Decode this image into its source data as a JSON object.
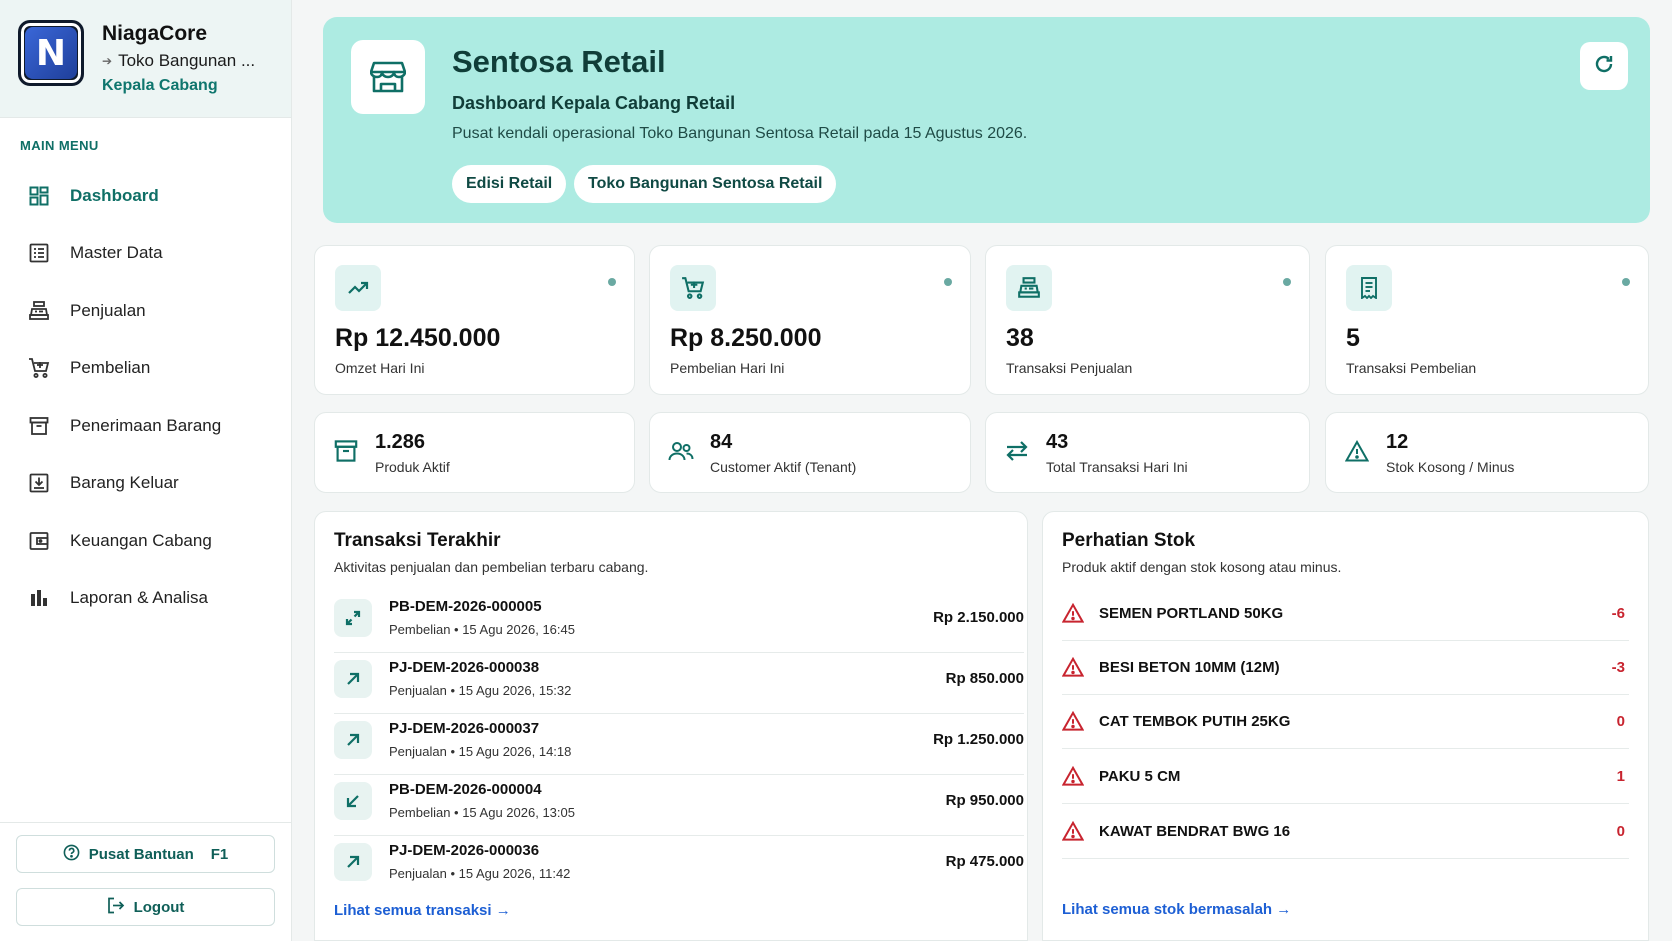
{
  "brand": {
    "name": "NiagaCore",
    "logo_letter": "N",
    "store": "Toko Bangunan ...",
    "role": "Kepala Cabang"
  },
  "sidebar": {
    "menu_title": "MAIN MENU",
    "items": [
      {
        "label": "Dashboard",
        "icon": "dashboard-grid-icon",
        "active": true
      },
      {
        "label": "Master Data",
        "icon": "list-icon"
      },
      {
        "label": "Penjualan",
        "icon": "cash-register-icon"
      },
      {
        "label": "Pembelian",
        "icon": "cart-icon"
      },
      {
        "label": "Penerimaan Barang",
        "icon": "archive-box-icon"
      },
      {
        "label": "Barang Keluar",
        "icon": "box-out-icon"
      },
      {
        "label": "Keuangan Cabang",
        "icon": "wallet-icon"
      },
      {
        "label": "Laporan & Analisa",
        "icon": "bar-chart-icon"
      }
    ],
    "help_label": "Pusat Bantuan",
    "help_key": "F1",
    "logout_label": "Logout"
  },
  "hero": {
    "title": "Sentosa Retail",
    "subtitle": "Dashboard Kepala Cabang Retail",
    "description": "Pusat kendali operasional Toko Bangunan Sentosa Retail pada 15 Agustus 2026.",
    "chips": [
      "Edisi Retail",
      "Toko Bangunan Sentosa Retail"
    ]
  },
  "stats": [
    {
      "value": "Rp 12.450.000",
      "label": "Omzet Hari Ini",
      "icon": "trending-up-icon"
    },
    {
      "value": "Rp 8.250.000",
      "label": "Pembelian Hari Ini",
      "icon": "cart-plus-icon"
    },
    {
      "value": "38",
      "label": "Transaksi Penjualan",
      "icon": "cash-register-icon"
    },
    {
      "value": "5",
      "label": "Transaksi Pembelian",
      "icon": "receipt-icon"
    }
  ],
  "mini_stats": [
    {
      "value": "1.286",
      "label": "Produk Aktif",
      "icon": "archive-box-icon"
    },
    {
      "value": "84",
      "label": "Customer Aktif (Tenant)",
      "icon": "users-icon"
    },
    {
      "value": "43",
      "label": "Total Transaksi Hari Ini",
      "icon": "swap-arrows-icon"
    },
    {
      "value": "12",
      "label": "Stok Kosong / Minus",
      "icon": "warning-icon"
    }
  ],
  "transactions": {
    "title": "Transaksi Terakhir",
    "subtitle": "Aktivitas penjualan dan pembelian terbaru cabang.",
    "items": [
      {
        "id": "PB-DEM-2026-000005",
        "meta": "Pembelian • 15 Agu 2026, 16:45",
        "amount": "Rp 2.150.000",
        "icon": "expand-arrows-icon"
      },
      {
        "id": "PJ-DEM-2026-000038",
        "meta": "Penjualan • 15 Agu 2026, 15:32",
        "amount": "Rp 850.000",
        "icon": "arrow-up-right-icon"
      },
      {
        "id": "PJ-DEM-2026-000037",
        "meta": "Penjualan • 15 Agu 2026, 14:18",
        "amount": "Rp 1.250.000",
        "icon": "arrow-up-right-icon"
      },
      {
        "id": "PB-DEM-2026-000004",
        "meta": "Pembelian • 15 Agu 2026, 13:05",
        "amount": "Rp 950.000",
        "icon": "arrow-down-left-icon"
      },
      {
        "id": "PJ-DEM-2026-000036",
        "meta": "Penjualan • 15 Agu 2026, 11:42",
        "amount": "Rp 475.000",
        "icon": "arrow-up-right-icon"
      }
    ],
    "link": "Lihat semua transaksi →"
  },
  "stock": {
    "title": "Perhatian Stok",
    "subtitle": "Produk aktif dengan stok kosong atau minus.",
    "items": [
      {
        "name": "SEMEN PORTLAND 50KG",
        "qty": "-6"
      },
      {
        "name": "BESI BETON 10MM (12M)",
        "qty": "-3"
      },
      {
        "name": "CAT TEMBOK PUTIH 25KG",
        "qty": "0"
      },
      {
        "name": "PAKU 5 CM",
        "qty": "1"
      },
      {
        "name": "KAWAT BENDRAT BWG 16",
        "qty": "0"
      }
    ],
    "link": "Lihat semua stok bermasalah →"
  },
  "colors": {
    "accent": "#0f6f66",
    "hero_bg": "#adebe2",
    "danger": "#c8242f",
    "link": "#1d5fd4"
  }
}
